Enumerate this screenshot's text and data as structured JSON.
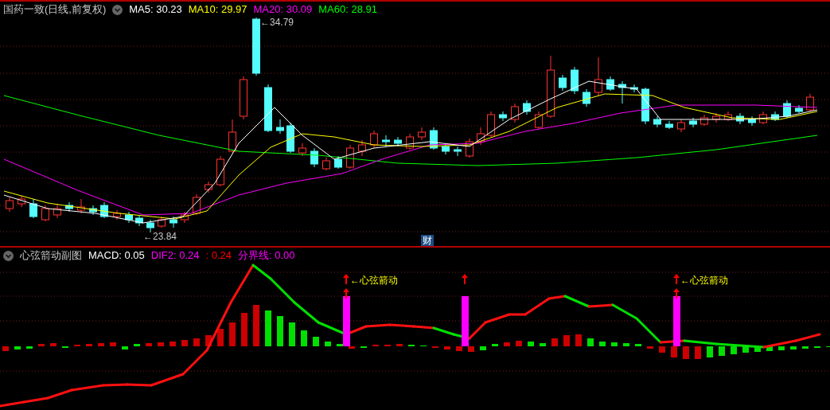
{
  "header": {
    "title": "国药一致(日线,前复权)",
    "indicators": [
      {
        "label": "MA5: 30.23",
        "color": "#ffffff"
      },
      {
        "label": "MA10: 29.97",
        "color": "#ffff00"
      },
      {
        "label": "MA20: 30.09",
        "color": "#ff00ff"
      },
      {
        "label": "MA60: 28.91",
        "color": "#00ff00"
      }
    ]
  },
  "price_chart": {
    "high_label": "←34.79",
    "low_label": "←23.84",
    "badge": "财"
  },
  "sub_header": {
    "title": "心弦箭动副图",
    "indicators": [
      {
        "label": "MACD: 0.05",
        "color": "#ffffff"
      },
      {
        "label": "DIF2: 0.24",
        "color": "#ff00ff"
      },
      {
        "label": ": 0.24",
        "color": "#ff0000"
      },
      {
        "label": "分界线: 0.00",
        "color": "#ff00ff"
      }
    ]
  },
  "signal_labels": [
    "←心弦箭动",
    "←心弦箭动"
  ]
}
